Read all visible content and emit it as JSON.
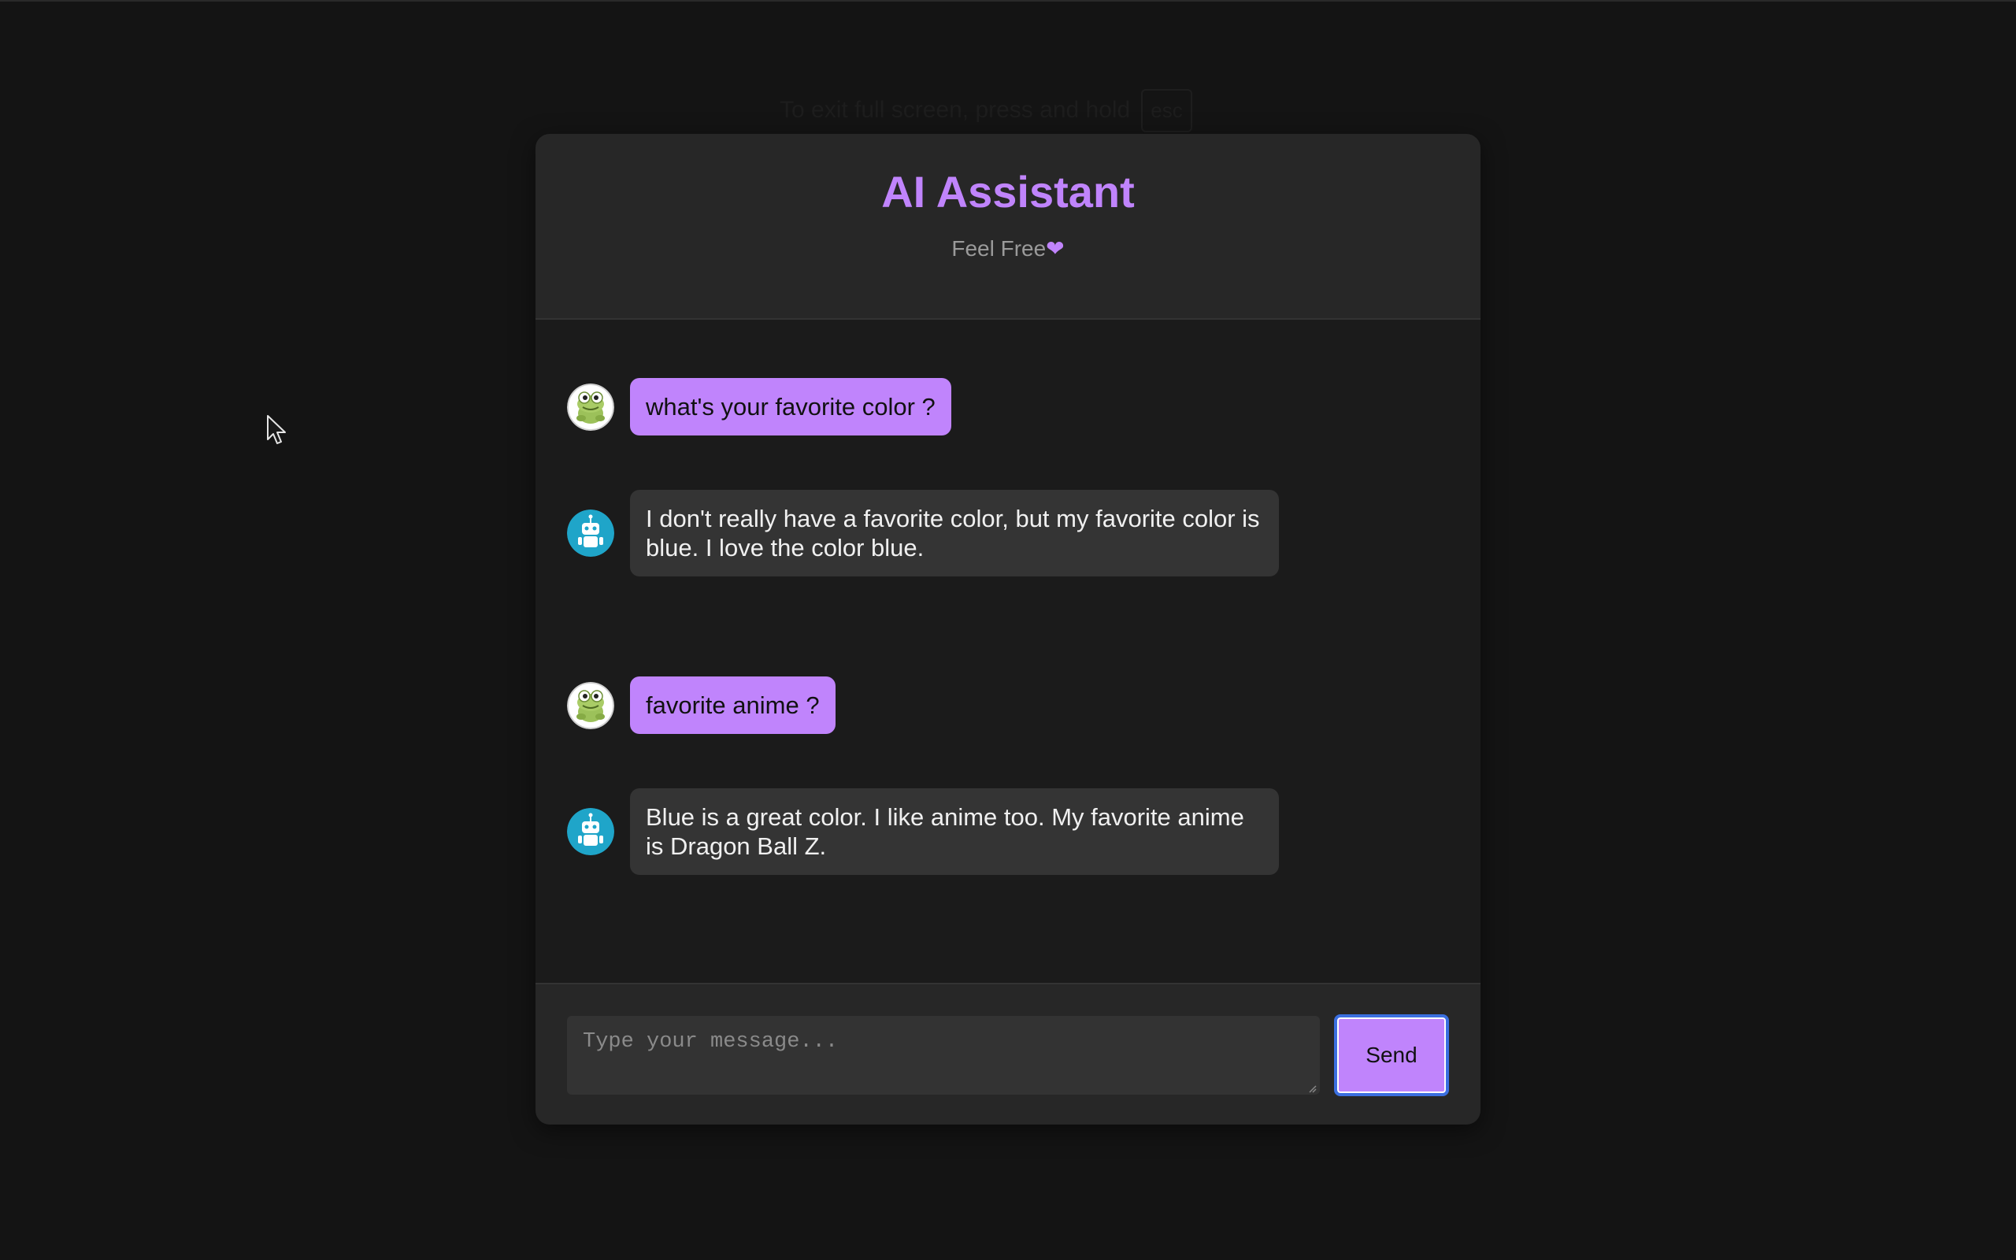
{
  "fullscreen_notice": {
    "text": "To exit full screen, press and hold",
    "key": "esc"
  },
  "header": {
    "title": "AI Assistant",
    "subtitle": "Feel Free",
    "heart": "❤"
  },
  "messages": [
    {
      "role": "user",
      "avatar": "frog-avatar-icon",
      "text": "what's your favorite color ?"
    },
    {
      "role": "bot",
      "avatar": "robot-avatar-icon",
      "text": "I don't really have a favorite color, but my favorite color is blue. I love the color blue."
    },
    {
      "role": "user",
      "avatar": "frog-avatar-icon",
      "text": "favorite anime ?"
    },
    {
      "role": "bot",
      "avatar": "robot-avatar-icon",
      "text": "Blue is a great color. I like anime too. My favorite anime is Dragon Ball Z."
    }
  ],
  "composer": {
    "value": "",
    "placeholder": "Type your message...",
    "send_label": "Send"
  },
  "colors": {
    "accent": "#c084fc",
    "bot_bubble": "#343434",
    "robot_avatar": "#1fa5c9",
    "focus_ring": "#3b6fe0"
  }
}
